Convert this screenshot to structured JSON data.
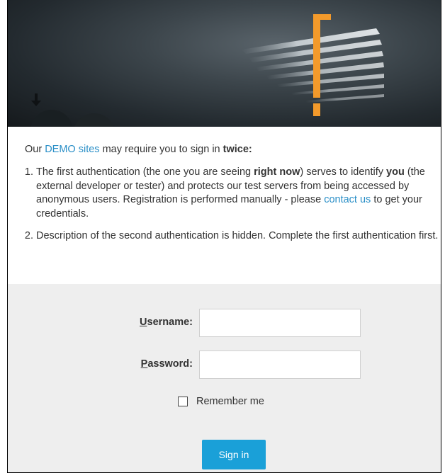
{
  "intro": {
    "prefix": "Our ",
    "demo_link": "DEMO sites",
    "middle": " may require you to sign in ",
    "emphasis": "twice:",
    "items": [
      {
        "part1": "The first authentication (the one you are seeing ",
        "bold1": "right now",
        "part2": ") serves to identify ",
        "bold2": "you",
        "part3": " (the external developer or tester) and protects our test servers from being accessed by anonymous users. Registration is performed manually - please ",
        "link": "contact us",
        "part4": " to get your credentials."
      },
      {
        "text": "Description of the second authentication is hidden. Complete the first authentication first."
      }
    ]
  },
  "login": {
    "username_label_underlined": "U",
    "username_label_rest": "sername:",
    "username_value": "",
    "password_label_underlined": "P",
    "password_label_rest": "assword:",
    "password_value": "",
    "remember_label": "Remember me",
    "remember_checked": false,
    "signin_label": "Sign in"
  },
  "colors": {
    "link": "#2a8fc7",
    "button": "#1aa0d8",
    "panel_bg": "#eeeeee",
    "hero_accent": "#f39a2b"
  },
  "icons": {
    "hero_arrow": "down-arrow-icon",
    "hero_logo": "exclamation-logo"
  }
}
